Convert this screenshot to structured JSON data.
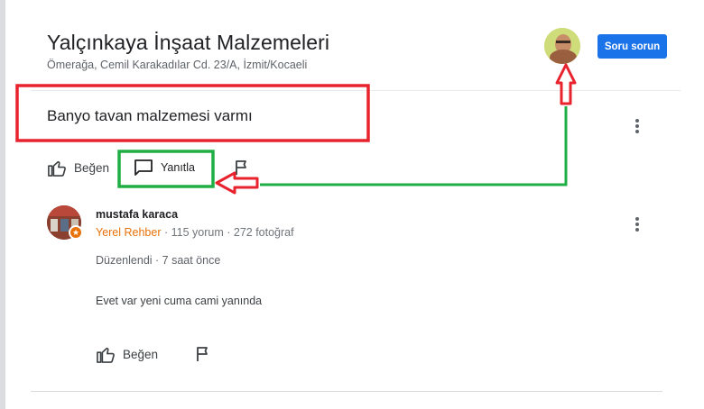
{
  "header": {
    "title": "Yalçınkaya İnşaat Malzemeleri",
    "address": "Ömerağa, Cemil Karakadılar Cd. 23/A, İzmit/Kocaeli",
    "ask_button": "Soru sorun"
  },
  "question": {
    "text": "Banyo tavan malzemesi varmı",
    "like_label": "Beğen",
    "reply_label": "Yanıtla"
  },
  "answer": {
    "author": "mustafa karaca",
    "guide_label": "Yerel Rehber",
    "separator": " · ",
    "review_count": "115 yorum",
    "photo_count": "272 fotoğraf",
    "edited": "Düzenlendi · 7 saat önce",
    "text": "Evet var yeni cuma cami yanında",
    "like_label": "Beğen"
  },
  "annotation_colors": {
    "red": "#e8232e",
    "green": "#1fae44"
  },
  "icons": [
    "thumb-up-icon",
    "reply-bubble-icon",
    "flag-icon",
    "more-vert-icon",
    "local-guide-star-icon"
  ]
}
